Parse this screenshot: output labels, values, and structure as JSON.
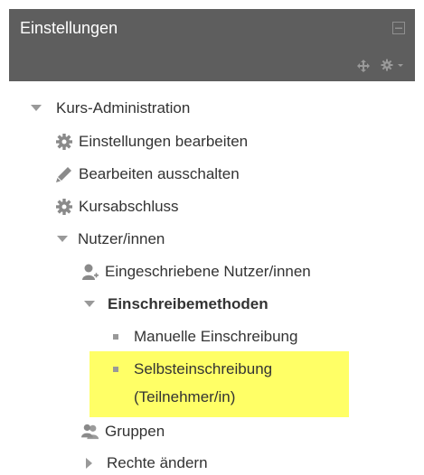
{
  "block": {
    "title": "Einstellungen",
    "icons": [
      "collapse-icon",
      "move-icon",
      "gear-menu-icon"
    ]
  },
  "tree": {
    "root": {
      "label": "Kurs-Administration",
      "state": "expanded"
    },
    "items": [
      {
        "label": "Einstellungen bearbeiten",
        "icon": "gear-icon"
      },
      {
        "label": "Bearbeiten ausschalten",
        "icon": "pencil-icon"
      },
      {
        "label": "Kursabschluss",
        "icon": "gear-icon"
      },
      {
        "label": "Nutzer/innen",
        "state": "expanded"
      },
      {
        "label": "Eingeschriebene Nutzer/innen",
        "icon": "enrolled-users-icon"
      },
      {
        "label": "Einschreibemethoden",
        "state": "expanded"
      },
      {
        "label": "Manuelle Einschreibung",
        "icon": "bullet"
      },
      {
        "label_line1": "Selbsteinschreibung",
        "label_line2": "(Teilnehmer/in)",
        "icon": "bullet",
        "highlighted": true
      },
      {
        "label": "Gruppen",
        "icon": "groups-icon"
      },
      {
        "label": "Rechte ändern",
        "state": "collapsed"
      }
    ]
  },
  "colors": {
    "header_bg": "#5e5e5e",
    "highlight": "#ffff66",
    "icon_gray": "#8a8a8a"
  }
}
